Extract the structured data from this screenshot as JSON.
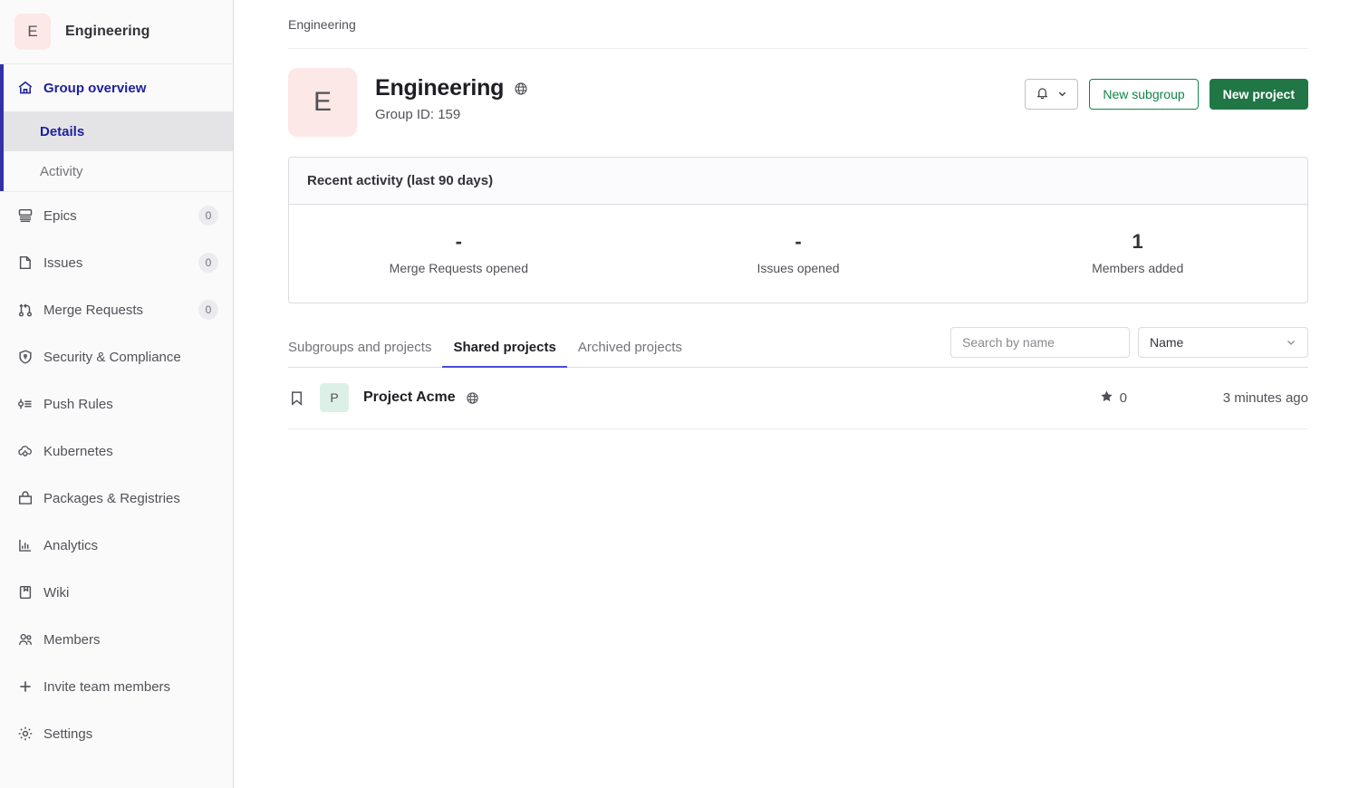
{
  "sidebar": {
    "group_initial": "E",
    "group_name": "Engineering",
    "overview": {
      "label": "Group overview",
      "icon": "home-icon",
      "subitems": [
        {
          "label": "Details",
          "current": true
        },
        {
          "label": "Activity",
          "current": false
        }
      ]
    },
    "items": [
      {
        "label": "Epics",
        "icon": "epic-icon",
        "badge": "0"
      },
      {
        "label": "Issues",
        "icon": "issue-icon",
        "badge": "0"
      },
      {
        "label": "Merge Requests",
        "icon": "merge-request-icon",
        "badge": "0"
      },
      {
        "label": "Security & Compliance",
        "icon": "shield-icon",
        "badge": ""
      },
      {
        "label": "Push Rules",
        "icon": "push-rules-icon",
        "badge": ""
      },
      {
        "label": "Kubernetes",
        "icon": "kubernetes-icon",
        "badge": ""
      },
      {
        "label": "Packages & Registries",
        "icon": "package-icon",
        "badge": ""
      },
      {
        "label": "Analytics",
        "icon": "chart-icon",
        "badge": ""
      },
      {
        "label": "Wiki",
        "icon": "book-icon",
        "badge": ""
      },
      {
        "label": "Members",
        "icon": "users-icon",
        "badge": ""
      },
      {
        "label": "Invite team members",
        "icon": "plus-icon",
        "badge": ""
      },
      {
        "label": "Settings",
        "icon": "gear-icon",
        "badge": ""
      }
    ]
  },
  "breadcrumb": {
    "text": "Engineering"
  },
  "header": {
    "avatar_initial": "E",
    "title": "Engineering",
    "visibility_icon": "globe-icon",
    "subtitle": "Group ID: 159",
    "notification_icon": "bell-icon",
    "notification_chevron": "chevron-down-icon",
    "new_subgroup_label": "New subgroup",
    "new_project_label": "New project"
  },
  "activity": {
    "title": "Recent activity (last 90 days)",
    "stats": [
      {
        "value": "-",
        "label": "Merge Requests opened"
      },
      {
        "value": "-",
        "label": "Issues opened"
      },
      {
        "value": "1",
        "label": "Members added"
      }
    ]
  },
  "tabs": [
    {
      "label": "Subgroups and projects",
      "active": false
    },
    {
      "label": "Shared projects",
      "active": true
    },
    {
      "label": "Archived projects",
      "active": false
    }
  ],
  "search": {
    "placeholder": "Search by name",
    "value": ""
  },
  "sort": {
    "value": "Name",
    "chevron": "chevron-down-icon"
  },
  "projects": [
    {
      "bookmark_icon": "bookmark-icon",
      "avatar_initial": "P",
      "name": "Project Acme",
      "visibility_icon": "globe-icon",
      "star_icon": "star-icon",
      "stars": "0",
      "updated": "3 minutes ago"
    }
  ],
  "colors": {
    "accent": "#3331a8",
    "tab_underline": "#4b4bd8",
    "primary_green": "#217645",
    "outline_green": "#108548",
    "group_avatar_bg": "#fce8e6",
    "project_avatar_bg": "#dcf0e8"
  }
}
